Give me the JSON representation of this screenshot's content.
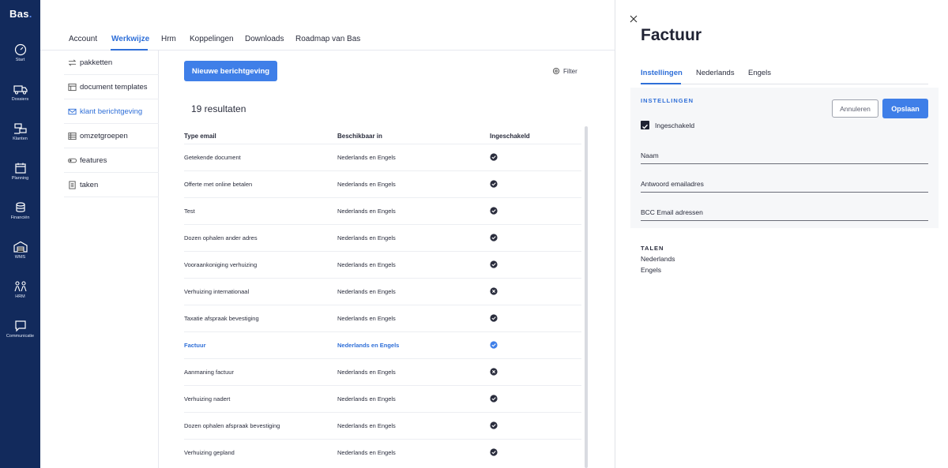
{
  "app": {
    "logo": "Bas"
  },
  "rail": [
    {
      "label": "Start",
      "icon": "gauge-icon"
    },
    {
      "label": "Dossiers",
      "icon": "truck-icon"
    },
    {
      "label": "Klanten",
      "icon": "people-icon"
    },
    {
      "label": "Planning",
      "icon": "calendar-icon"
    },
    {
      "label": "Financiën",
      "icon": "coins-icon"
    },
    {
      "label": "WMS",
      "icon": "warehouse-icon"
    },
    {
      "label": "HRM",
      "icon": "team-icon"
    },
    {
      "label": "Communicatie",
      "icon": "chat-icon"
    }
  ],
  "topnav": {
    "tabs": [
      "Account",
      "Werkwijze",
      "Hrm",
      "Koppelingen",
      "Downloads",
      "Roadmap van Bas"
    ],
    "active": "Werkwijze"
  },
  "submenu": [
    {
      "label": "pakketten",
      "icon": "swap-icon"
    },
    {
      "label": "document templates",
      "icon": "template-icon"
    },
    {
      "label": "klant berichtgeving",
      "icon": "mail-icon"
    },
    {
      "label": "omzetgroepen",
      "icon": "table-icon"
    },
    {
      "label": "features",
      "icon": "toggle-icon"
    },
    {
      "label": "taken",
      "icon": "checklist-icon"
    }
  ],
  "main": {
    "new_button": "Nieuwe berichtgeving",
    "filter_label": "Filter",
    "results": "19 resultaten",
    "columns": [
      "Type email",
      "Beschikbaar in",
      "Ingeschakeld"
    ],
    "rows": [
      {
        "type": "Getekende document",
        "lang": "Nederlands en Engels",
        "enabled": true
      },
      {
        "type": "Offerte met online betalen",
        "lang": "Nederlands en Engels",
        "enabled": true
      },
      {
        "type": "Test",
        "lang": "Nederlands en Engels",
        "enabled": true
      },
      {
        "type": "Dozen ophalen ander adres",
        "lang": "Nederlands en Engels",
        "enabled": true
      },
      {
        "type": "Vooraankoniging verhuizing",
        "lang": "Nederlands en Engels",
        "enabled": true
      },
      {
        "type": "Verhuizing internationaal",
        "lang": "Nederlands en Engels",
        "enabled": false
      },
      {
        "type": "Taxatie afspraak bevestiging",
        "lang": "Nederlands en Engels",
        "enabled": true
      },
      {
        "type": "Factuur",
        "lang": "Nederlands en Engels",
        "enabled": true,
        "selected": true
      },
      {
        "type": "Aanmaning factuur",
        "lang": "Nederlands en Engels",
        "enabled": false
      },
      {
        "type": "Verhuizing nadert",
        "lang": "Nederlands en Engels",
        "enabled": true
      },
      {
        "type": "Dozen ophalen afspraak bevestiging",
        "lang": "Nederlands en Engels",
        "enabled": true
      },
      {
        "type": "Verhuizing gepland",
        "lang": "Nederlands en Engels",
        "enabled": true
      }
    ]
  },
  "panel": {
    "title": "Factuur",
    "tabs": [
      "Instellingen",
      "Nederlands",
      "Engels"
    ],
    "section_title": "INSTELLINGEN",
    "cancel": "Annuleren",
    "save": "Opslaan",
    "checkbox_label": "Ingeschakeld",
    "fields": [
      "Naam",
      "Antwoord emailadres",
      "BCC Email adressen"
    ],
    "talen_title": "TALEN",
    "talen": [
      "Nederlands",
      "Engels"
    ]
  },
  "colors": {
    "rail": "#122a5c",
    "accent": "#3f7fe8",
    "link": "#2f6fd8"
  }
}
